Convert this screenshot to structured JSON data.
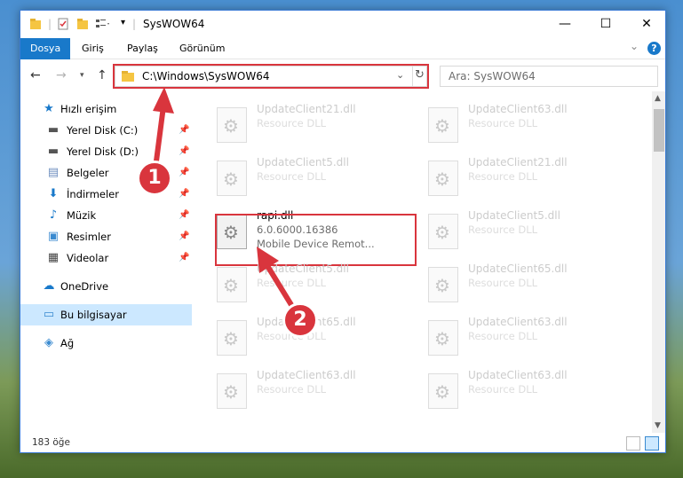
{
  "window": {
    "title": "SysWOW64",
    "minimize": "—",
    "maximize": "☐",
    "close": "✕"
  },
  "ribbon": {
    "tabs": [
      {
        "label": "Dosya",
        "active": true
      },
      {
        "label": "Giriş"
      },
      {
        "label": "Paylaş"
      },
      {
        "label": "Görünüm"
      }
    ],
    "expand": "⌄",
    "help": "?"
  },
  "address": {
    "path": "C:\\Windows\\SysWOW64",
    "search_placeholder": "Ara: SysWOW64"
  },
  "nav": {
    "items": [
      {
        "label": "Hızlı erişim",
        "icon": "★"
      },
      {
        "label": "Yerel Disk (C:)",
        "icon": "▬"
      },
      {
        "label": "Yerel Disk (D:)",
        "icon": "▬"
      },
      {
        "label": "Belgeler",
        "icon": "▤"
      },
      {
        "label": "İndirmeler",
        "icon": "⬇"
      },
      {
        "label": "Müzik",
        "icon": "♪"
      },
      {
        "label": "Resimler",
        "icon": "▣"
      },
      {
        "label": "Videolar",
        "icon": "▦"
      },
      {
        "label": "OneDrive",
        "icon": "☁"
      },
      {
        "label": "Bu bilgisayar",
        "icon": "▭"
      },
      {
        "label": "Ağ",
        "icon": "◈"
      }
    ]
  },
  "files": {
    "col1": [
      {
        "name": "UpdateClient21.dll",
        "desc": "Resource DLL"
      },
      {
        "name": "UpdateClient5.dll",
        "desc": "Resource DLL"
      },
      {
        "name": "rapi.dll",
        "desc": "6.0.6000.16386",
        "desc2": "Mobile Device Remot..."
      },
      {
        "name": "UpdateClient5.dll",
        "desc": "Resource DLL"
      },
      {
        "name": "UpdateClient65.dll",
        "desc": "Resource DLL"
      },
      {
        "name": "UpdateClient63.dll",
        "desc": "Resource DLL"
      }
    ],
    "col2": [
      {
        "name": "UpdateClient63.dll",
        "desc": "Resource DLL"
      },
      {
        "name": "UpdateClient21.dll",
        "desc": "Resource DLL"
      },
      {
        "name": "UpdateClient5.dll",
        "desc": "Resource DLL"
      },
      {
        "name": "UpdateClient65.dll",
        "desc": "Resource DLL"
      },
      {
        "name": "UpdateClient63.dll",
        "desc": "Resource DLL"
      },
      {
        "name": "UpdateClient63.dll",
        "desc": "Resource DLL"
      }
    ]
  },
  "status": {
    "count": "183 öğe"
  },
  "annotations": {
    "badge1": "1",
    "badge2": "2"
  },
  "colors": {
    "accent": "#1979ca",
    "highlight": "#d9353d",
    "selection": "#cce8ff"
  }
}
